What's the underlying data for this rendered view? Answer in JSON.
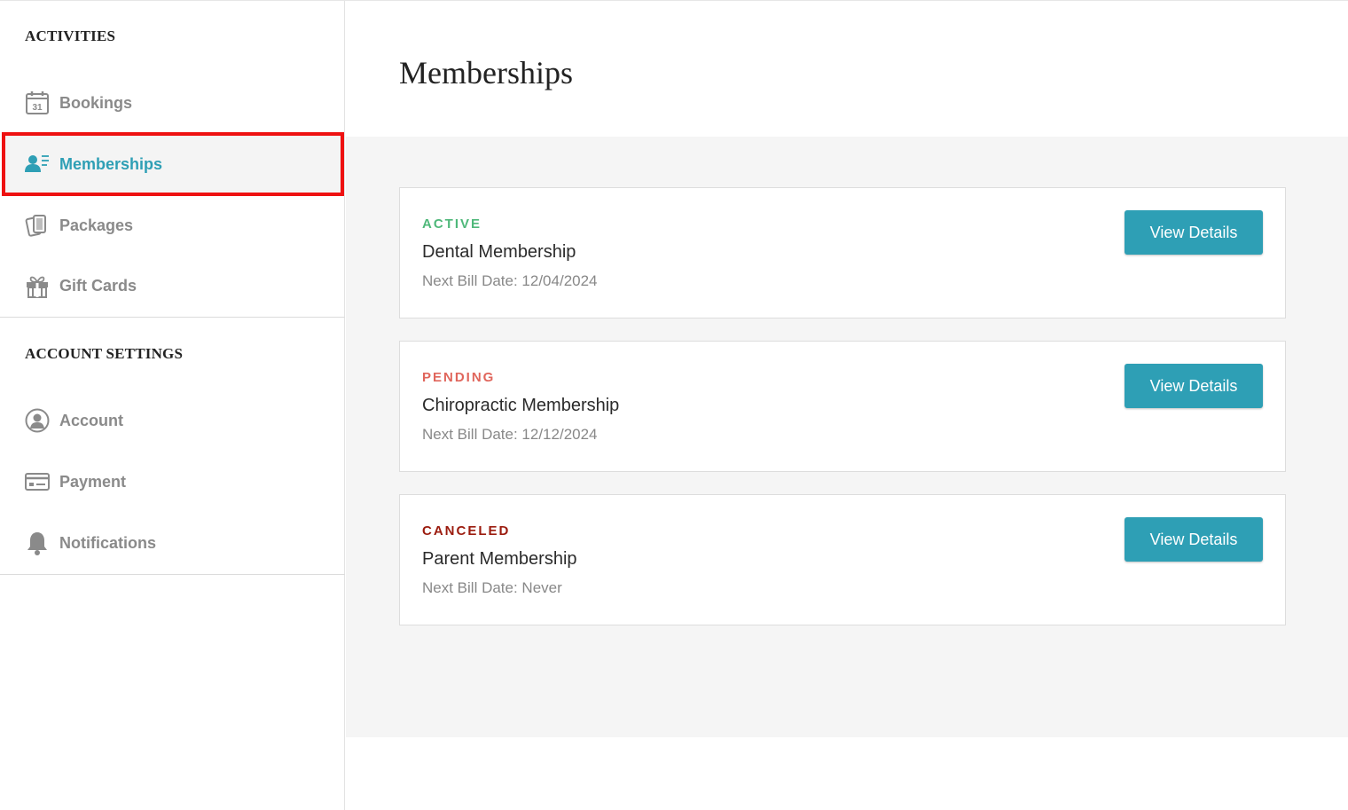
{
  "sidebar": {
    "activities_title": "ACTIVITIES",
    "activities_items": [
      {
        "label": "Bookings",
        "icon": "calendar-icon",
        "calendar_day": "31"
      },
      {
        "label": "Memberships",
        "icon": "membership-card-icon"
      },
      {
        "label": "Packages",
        "icon": "packages-icon"
      },
      {
        "label": "Gift Cards",
        "icon": "gift-icon"
      }
    ],
    "account_title": "ACCOUNT SETTINGS",
    "account_items": [
      {
        "label": "Account",
        "icon": "user-circle-icon"
      },
      {
        "label": "Payment",
        "icon": "credit-card-icon"
      },
      {
        "label": "Notifications",
        "icon": "bell-icon"
      }
    ],
    "active_item": "Memberships"
  },
  "main": {
    "title": "Memberships",
    "memberships": [
      {
        "status": "ACTIVE",
        "status_color": "#4fb87a",
        "name": "Dental Membership",
        "next_bill": "Next Bill Date: 12/04/2024",
        "button_label": "View Details"
      },
      {
        "status": "PENDING",
        "status_color": "#e0665c",
        "name": "Chiropractic Membership",
        "next_bill": "Next Bill Date: 12/12/2024",
        "button_label": "View Details"
      },
      {
        "status": "CANCELED",
        "status_color": "#9b1b0e",
        "name": "Parent Membership",
        "next_bill": "Next Bill Date: Never",
        "button_label": "View Details"
      }
    ]
  },
  "colors": {
    "accent": "#2e9fb5",
    "highlight_outline": "#ee1111",
    "icon_gray": "#8a8a8a"
  }
}
